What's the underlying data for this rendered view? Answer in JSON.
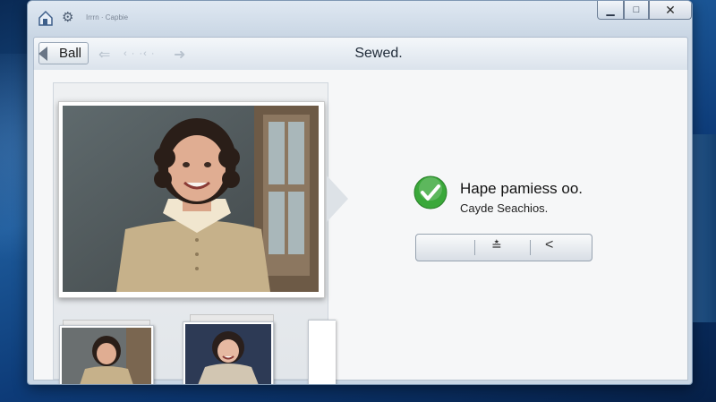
{
  "window": {
    "title": "Irrrn · Capbie",
    "controls": {
      "minimize": "▁",
      "maximize": "□",
      "close": "✕"
    }
  },
  "nav": {
    "back_label": "Ball",
    "page_title": "Sewed.",
    "faded_dots": "‹ ·  ·‹ ·"
  },
  "status": {
    "title": "Hape pamiess oo.",
    "subtitle": "Cayde Seachios."
  },
  "action_bar": {
    "sliders_icon": "≛",
    "back_icon": "<"
  },
  "colors": {
    "accent_green": "#3aa83a",
    "desktop_blue": "#1d5a9a"
  }
}
